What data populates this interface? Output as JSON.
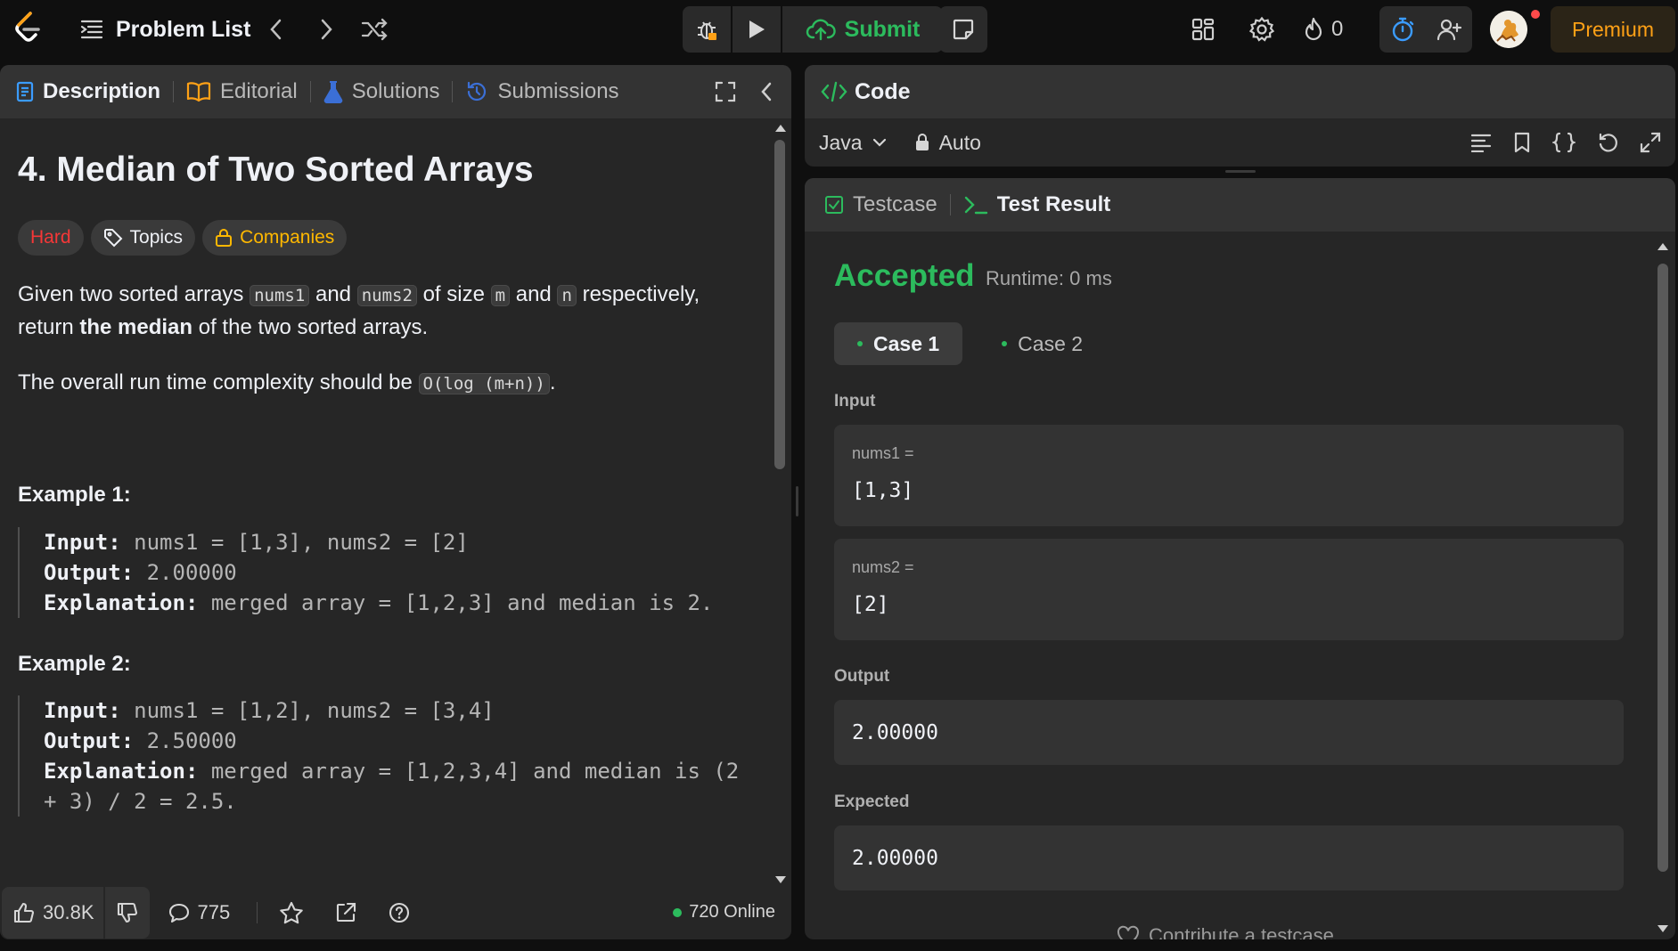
{
  "topbar": {
    "problem_list": "Problem List",
    "submit": "Submit",
    "streak_count": "0",
    "premium": "Premium"
  },
  "left": {
    "tabs": [
      "Description",
      "Editorial",
      "Solutions",
      "Submissions"
    ],
    "title": "4. Median of Two Sorted Arrays",
    "badges": {
      "difficulty": "Hard",
      "topics": "Topics",
      "companies": "Companies"
    },
    "desc": {
      "p1_a": "Given two sorted arrays ",
      "p1_code1": "nums1",
      "p1_b": " and ",
      "p1_code2": "nums2",
      "p1_c": " of size ",
      "p1_code3": "m",
      "p1_d": " and ",
      "p1_code4": "n",
      "p1_e": " respectively,",
      "p1_f": "return ",
      "p1_bold": "the median",
      "p1_g": " of the two sorted arrays.",
      "p2_a": "The overall run time complexity should be ",
      "p2_code": "O(log (m+n))",
      "p2_b": "."
    },
    "example1": {
      "title": "Example 1:",
      "input_label": "Input:",
      "input": " nums1 = [1,3], nums2 = [2]",
      "output_label": "Output:",
      "output": " 2.00000",
      "expl_label": "Explanation:",
      "expl": " merged array = [1,2,3] and median is 2."
    },
    "example2": {
      "title": "Example 2:",
      "input_label": "Input:",
      "input": " nums1 = [1,2], nums2 = [3,4]",
      "output_label": "Output:",
      "output": " 2.50000",
      "expl_label": "Explanation:",
      "expl1": " merged array = [1,2,3,4] and median is (2",
      "expl2": "+ 3) / 2 = 2.5."
    },
    "footer": {
      "likes": "30.8K",
      "comments": "775",
      "online": "720 Online"
    }
  },
  "code": {
    "title": "Code",
    "language": "Java",
    "mode": "Auto"
  },
  "result": {
    "tabs": [
      "Testcase",
      "Test Result"
    ],
    "status": "Accepted",
    "runtime": "Runtime: 0 ms",
    "cases": [
      "Case 1",
      "Case 2"
    ],
    "input_label": "Input",
    "nums1_label": "nums1 =",
    "nums1_value": "[1,3]",
    "nums2_label": "nums2 =",
    "nums2_value": "[2]",
    "output_label": "Output",
    "output_value": "2.00000",
    "expected_label": "Expected",
    "expected_value": "2.00000",
    "contribute": "Contribute a testcase"
  },
  "colors": {
    "accent_green": "#2cbb5d",
    "hard_red": "#f63737",
    "premium_orange": "#ffa116",
    "companies_yellow": "#ffb800"
  }
}
